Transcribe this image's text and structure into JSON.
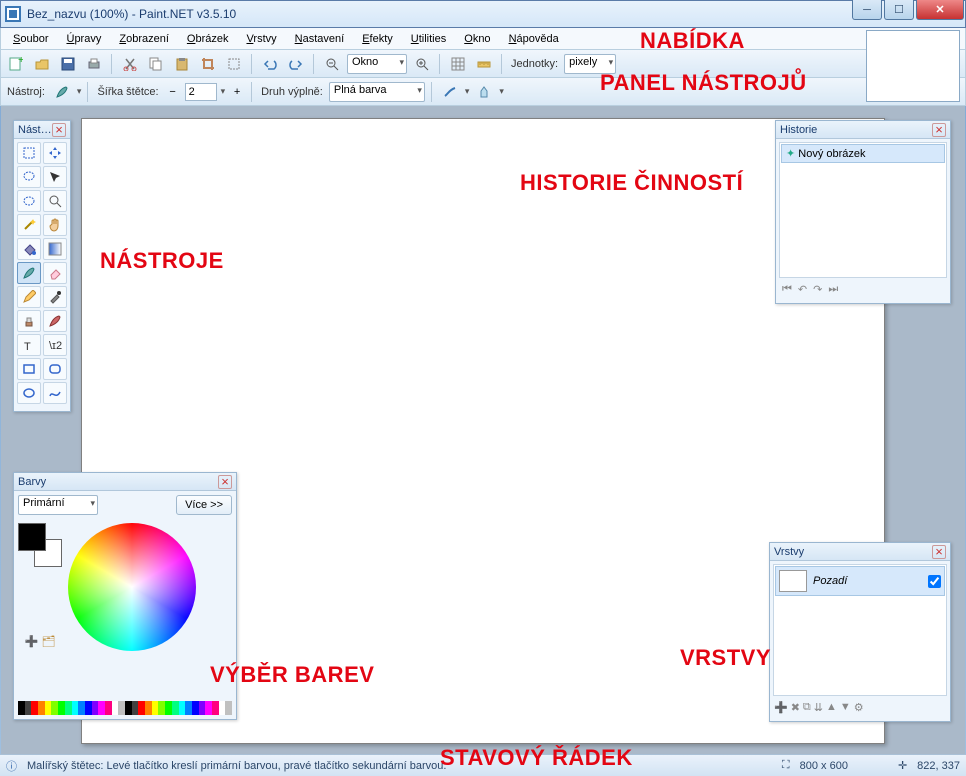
{
  "title": "Bez_nazvu (100%) - Paint.NET v3.5.10",
  "menu": [
    "Soubor",
    "Úpravy",
    "Zobrazení",
    "Obrázek",
    "Vrstvy",
    "Nastavení",
    "Efekty",
    "Utilities",
    "Okno",
    "Nápověda"
  ],
  "toolbar1": {
    "zoom_combo": "Okno",
    "units_label": "Jednotky:",
    "units_value": "pixely"
  },
  "toolbar2": {
    "tool_label": "Nástroj:",
    "width_label": "Šířka štětce:",
    "width_value": "2",
    "fill_label": "Druh výplně:",
    "fill_value": "Plná barva"
  },
  "panels": {
    "tools_title": "Nást…",
    "history_title": "Historie",
    "history_item": "Nový obrázek",
    "layers_title": "Vrstvy",
    "layer_name": "Pozadí",
    "colors_title": "Barvy",
    "colors_primary": "Primární",
    "colors_more": "Více >>"
  },
  "status": {
    "hint": "Malířský štětec: Levé tlačítko kreslí primární barvou, pravé tlačítko sekundární barvou.",
    "size": "800 x 600",
    "pos": "822, 337"
  },
  "annotations": {
    "menu": "NABÍDKA",
    "toolbar": "PANEL NÁSTROJŮ",
    "tools": "NÁSTROJE",
    "history": "HISTORIE  ČINNOSTÍ",
    "colors": "VÝBĚR BAREV",
    "layers": "VRSTVY",
    "status": "STAVOVÝ ŘÁDEK"
  },
  "palette": [
    "#000",
    "#404040",
    "#f00",
    "#ff8000",
    "#ff0",
    "#80ff00",
    "#0f0",
    "#00ff80",
    "#0ff",
    "#0080ff",
    "#00f",
    "#8000ff",
    "#f0f",
    "#ff0080",
    "#fff",
    "#c0c0c0"
  ]
}
